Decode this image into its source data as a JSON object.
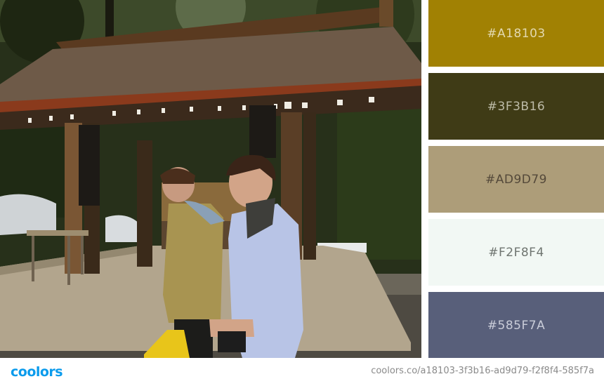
{
  "photo": {
    "description_icon": "photo-shrine-two-men"
  },
  "palette": {
    "swatches": [
      {
        "hex": "#A18103",
        "label": "#A18103",
        "text_color": "#e3d9b0"
      },
      {
        "hex": "#3F3B16",
        "label": "#3F3B16",
        "text_color": "#bdbba8"
      },
      {
        "hex": "#AD9D79",
        "label": "#AD9D79",
        "text_color": "#54493a"
      },
      {
        "hex": "#F2F8F4",
        "label": "#F2F8F4",
        "text_color": "#6f7570"
      },
      {
        "hex": "#585F7A",
        "label": "#585F7A",
        "text_color": "#c9ccd8"
      }
    ]
  },
  "footer": {
    "logo_text": "coolors",
    "url": "coolors.co/a18103-3f3b16-ad9d79-f2f8f4-585f7a"
  }
}
